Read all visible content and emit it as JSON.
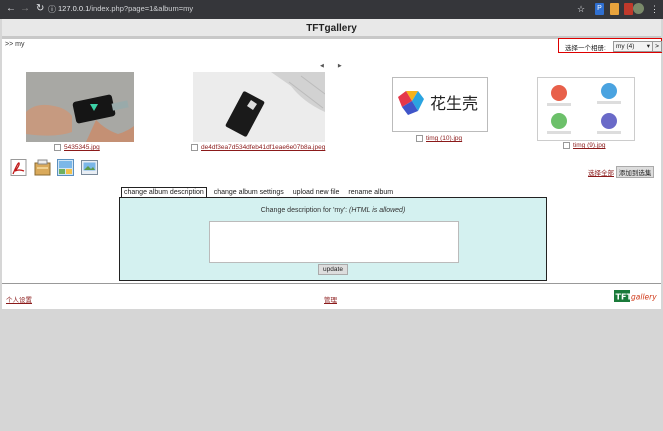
{
  "browser": {
    "url_host": "127.0.0.1",
    "url_path": "/index.php?page=1&album=my"
  },
  "app": {
    "title": "TFTgallery"
  },
  "breadcrumb": ">> my",
  "album_selector": {
    "label": "选择一个相册:",
    "selected": "my (4)",
    "go_label": ">"
  },
  "gallery_nav": {
    "prev": "◀",
    "next": "▶"
  },
  "images": [
    {
      "filename": "5435345.jpg"
    },
    {
      "filename": "de4df3ea7d534dfeb41df1eae6e07b8a.jpeg"
    },
    {
      "filename": "timg (10).jpg",
      "logo_text": "花生壳"
    },
    {
      "filename": "timg (9).jpg"
    }
  ],
  "tools": [
    "pdf-icon",
    "package-icon",
    "image-gallery-icon",
    "slideshow-icon"
  ],
  "selection": {
    "select_all": "选择全部",
    "add_to_album": "添加到选集"
  },
  "tabs": [
    {
      "label": "change album description",
      "active": true
    },
    {
      "label": "change album settings",
      "active": false
    },
    {
      "label": "upload new file",
      "active": false
    },
    {
      "label": "rename album",
      "active": false
    }
  ],
  "description_panel": {
    "prompt": "Change description for 'my':",
    "note": "(HTML is allowed)",
    "textarea_value": "",
    "update_label": "update"
  },
  "footer": {
    "personal_settings": "个人设置",
    "admin": "管理",
    "logo_tft": "TFT",
    "logo_gallery": "gallery"
  },
  "colors": {
    "link": "#8b1a1a",
    "panel_bg": "#d4f1f0",
    "highlight_border": "#dd0000"
  }
}
